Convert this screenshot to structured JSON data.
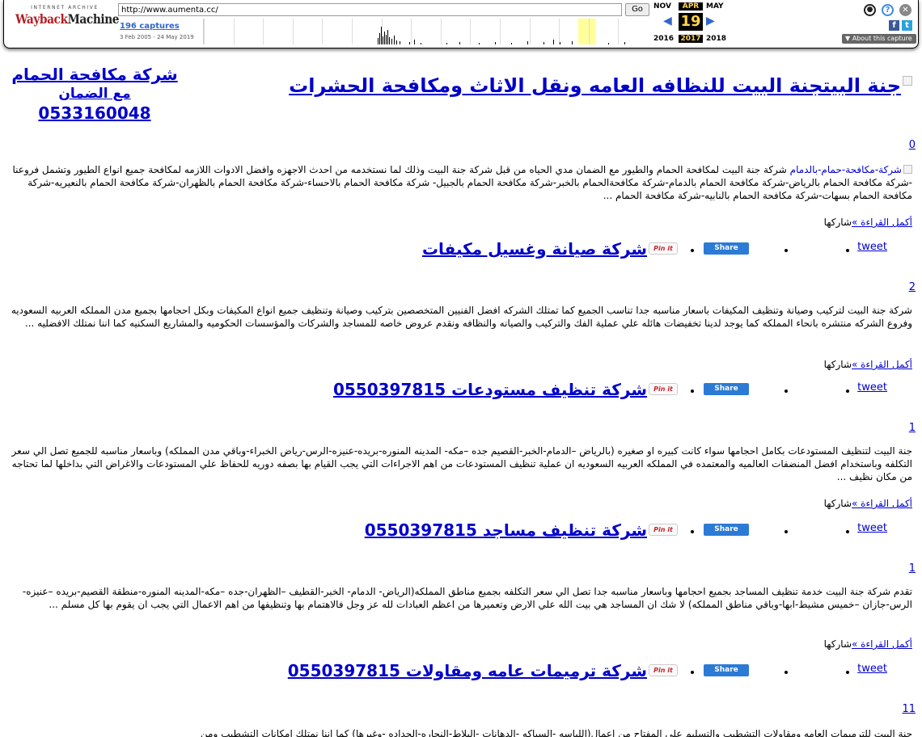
{
  "wayback": {
    "ia_label": "INTERNET ARCHIVE",
    "logo_red": "Wayback",
    "logo_dark": "Machine",
    "url": "http://www.aumenta.cc/",
    "go_label": "Go",
    "captures_label": "196 captures",
    "date_range": "3 Feb 2005 - 24 May 2019",
    "prev_month": "NOV",
    "cur_month": "APR",
    "next_month": "MAY",
    "day": "19",
    "prev_year": "2016",
    "cur_year": "2017",
    "next_year": "2018",
    "about_label": "▼ About this capture",
    "icons": [
      "user-icon",
      "help-icon",
      "close-icon",
      "facebook-icon",
      "twitter-icon"
    ]
  },
  "header": {
    "site_title": "جنة البيتجنة البيت للنظافه العامه ونقل الاثاث ومكافحة الحشرات",
    "tagline_line1": "شركة مكافحة الحمام",
    "tagline_line2": "مع الضمان",
    "tagline_phone": "0533160048"
  },
  "common": {
    "read_more": "أكمل القراءة »",
    "share_it": "شاركها",
    "pin_label": "Pin it",
    "share_label": "Share",
    "tweet_label": "tweet"
  },
  "posts": [
    {
      "count": "0",
      "image_alt": "شركة-مكافحة-حمام-بالدمام",
      "excerpt": " شركة جنة البيت لمكافحة الحمام والطيور مع الضمان مدي الحياه من قبل شركة جنة البيت وذلك لما نستخدمه من احدث الاجهزه وافضل الادوات اللازمه لمكافحة جميع انواع الطيور وتشمل فروعنا -شركة مكافحة الحمام بالرياض-شركة مكافحة الحمام بالدمام-شركة مكافحةالحمام بالخبر-شركة مكافحة الحمام بالجبيل- شركة مكافحة الحمام بالاحساء-شركة مكافحة الحمام بالظهران-شركة مكافحة الحمام بالنعيريه-شركة مكافحة الحمام بسهات-شركة مكافحة الحمام بالنابيه-شركة مكافحة الحمام ...",
      "next_title": "شركة صيانة وغسيل مكيفات"
    },
    {
      "count": "2",
      "excerpt": " شركة جنة البيت لتركيب وصيانة وتنظيف المكيفات باسعار مناسبه جدا تناسب الجميع كما تمتلك الشركه افضل الفنيين المتخصصين بتركيب وصيانة وتنظيف جميع انواع المكيفات وبكل احجامها بجميع مدن المملكه العربيه السعوديه وفروع الشركه منتشره بانحاء المملكه كما يوجد لدينا تخفيضات هائله علي عملية الفك والتركيب والصيانه والنظافه ونقدم عروض خاصه للمساجد والشركات والمؤسسات الحكوميه والمشاريع السكنيه كما اننا نمتلك الافضليه ...",
      "next_title": "شركة تنظيف مستودعات 0550397815"
    },
    {
      "count": "1",
      "excerpt": "جنة البيت لتنظيف المستودعات بكامل احجامها سواء كانت كبيره او صغيره (بالرياض –الدمام-الخبر-القصيم جده –مكه- المدينه المنوره-بريده-عنيزه-الرس-رياض الخبراء-وباقي مدن المملكه) وباسعار مناسبه للجميع تصل الي سعر التكلفه وباستخدام افضل المنضفات العالميه والمعتمده في المملكه العربيه السعوديه ان عملية تنظيف المستودعات من اهم الاجراءات التي يجب القيام بها بصفه دوريه للحفاظ علي المستودعات والاغراض التي بداخلها لما تحتاجه من مكان نظيف ...",
      "next_title": "شركة تنظيف مساجد 0550397815"
    },
    {
      "count": "1",
      "excerpt": " تقدم شركة جنة البيت خدمة تنظيف المساجد بجميع احجامها وباسعار مناسبه جدا تصل الي سعر التكلفه بجميع مناطق المملكه(الرياض- الدمام- الخبر-القطيف –الظهران-جده –مكه-المدينه المنوره-منطقة القصيم-بريده –عنيزه-الرس-جازان –خميس مشيط-ابها-وباقي مناطق المملكه)  لا شك ان المساجد هي بيت الله علي الارض وتعميرها من اعظم العبادات لله عز وجل فالاهتمام بها وتنظيفها من اهم الاعمال التي يجب ان يقوم بها كل مسلم ...",
      "next_title": "شركة ترميمات عامه ومقاولات 0550397815"
    },
    {
      "count": "11",
      "excerpt": "جنة البيت للترميمات العامه ومقاولات التشطيب والتسليم علي المفتاح من اعمال(اللياسه -السباكه -الدهانات -البلاط-النجاره-الحداده -وغيرها) كما اننا نمتلك امكانات التشطيب ومن"
    }
  ]
}
